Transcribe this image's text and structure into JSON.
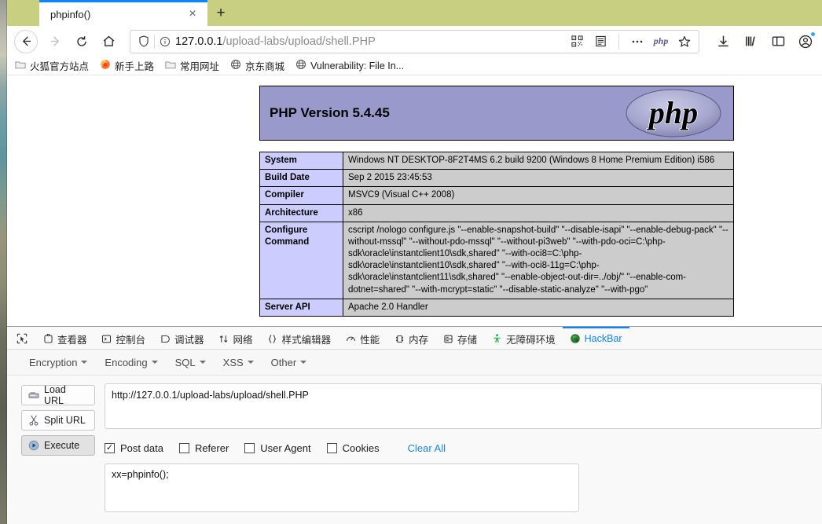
{
  "browser": {
    "tab": {
      "title": "phpinfo()",
      "close_label": "×"
    },
    "newtab_label": "+",
    "nav": {
      "back": "back-arrow",
      "forward": "forward-arrow",
      "reload": "reload",
      "home": "home"
    },
    "url": {
      "host": "127.0.0.1",
      "path": "/upload-labs/upload/shell.PHP",
      "full": "127.0.0.1/upload-labs/upload/shell.PHP",
      "php_badge": "php"
    },
    "url_icons": [
      "qr-code-icon",
      "reader-mode-icon",
      "page-actions-icon",
      "php-icon",
      "bookmark-star-icon"
    ],
    "toolbar_icons": [
      "downloads-icon",
      "library-icon",
      "sidebar-icon",
      "account-icon"
    ],
    "bookmarks": [
      {
        "label": "火狐官方站点",
        "icon": "folder-icon"
      },
      {
        "label": "新手上路",
        "icon": "firefox-icon"
      },
      {
        "label": "常用网址",
        "icon": "folder-icon"
      },
      {
        "label": "京东商城",
        "icon": "globe-icon"
      },
      {
        "label": "Vulnerability: File In...",
        "icon": "globe-icon"
      }
    ]
  },
  "phpinfo": {
    "version_title": "PHP Version 5.4.45",
    "logo_text": "php",
    "rows": [
      {
        "key": "System",
        "value": "Windows NT DESKTOP-8F2T4MS 6.2 build 9200 (Windows 8 Home Premium Edition) i586"
      },
      {
        "key": "Build Date",
        "value": "Sep 2 2015 23:45:53"
      },
      {
        "key": "Compiler",
        "value": "MSVC9 (Visual C++ 2008)"
      },
      {
        "key": "Architecture",
        "value": "x86"
      },
      {
        "key": "Configure Command",
        "value": "cscript /nologo configure.js \"--enable-snapshot-build\" \"--disable-isapi\" \"--enable-debug-pack\" \"--without-mssql\" \"--without-pdo-mssql\" \"--without-pi3web\" \"--with-pdo-oci=C:\\php-sdk\\oracle\\instantclient10\\sdk,shared\" \"--with-oci8=C:\\php-sdk\\oracle\\instantclient10\\sdk,shared\" \"--with-oci8-11g=C:\\php-sdk\\oracle\\instantclient11\\sdk,shared\" \"--enable-object-out-dir=../obj/\" \"--enable-com-dotnet=shared\" \"--with-mcrypt=static\" \"--disable-static-analyze\" \"--with-pgo\""
      },
      {
        "key": "Server API",
        "value": "Apache 2.0 Handler"
      }
    ]
  },
  "devtools": {
    "tabs": [
      {
        "label": "",
        "icon": "element-picker-icon",
        "active": false
      },
      {
        "label": "查看器",
        "icon": "inspector-icon",
        "active": false
      },
      {
        "label": "控制台",
        "icon": "console-icon",
        "active": false
      },
      {
        "label": "调试器",
        "icon": "debugger-icon",
        "active": false
      },
      {
        "label": "网络",
        "icon": "network-icon",
        "active": false
      },
      {
        "label": "样式编辑器",
        "icon": "style-editor-icon",
        "active": false
      },
      {
        "label": "性能",
        "icon": "performance-icon",
        "active": false
      },
      {
        "label": "内存",
        "icon": "memory-icon",
        "active": false
      },
      {
        "label": "存储",
        "icon": "storage-icon",
        "active": false
      },
      {
        "label": "无障碍环境",
        "icon": "accessibility-icon",
        "active": false
      },
      {
        "label": "HackBar",
        "icon": "hackbar-icon",
        "active": true
      }
    ],
    "accent_color": "#0a84ff"
  },
  "hackbar": {
    "menus": [
      "Encryption",
      "Encoding",
      "SQL",
      "XSS",
      "Other"
    ],
    "buttons": [
      {
        "label": "Load URL",
        "icon": "load-url-icon",
        "pressed": false
      },
      {
        "label": "Split URL",
        "icon": "split-url-icon",
        "pressed": false
      },
      {
        "label": "Execute",
        "icon": "execute-icon",
        "pressed": true
      }
    ],
    "url_value": "http://127.0.0.1/upload-labs/upload/shell.PHP",
    "url_placeholder": "",
    "checkboxes": [
      {
        "label": "Post data",
        "checked": true,
        "mark": "✓"
      },
      {
        "label": "Referer",
        "checked": false,
        "mark": ""
      },
      {
        "label": "User Agent",
        "checked": false,
        "mark": ""
      },
      {
        "label": "Cookies",
        "checked": false,
        "mark": ""
      }
    ],
    "clear_all_label": "Clear All",
    "post_data_value": "xx=phpinfo();",
    "post_data_placeholder": ""
  }
}
